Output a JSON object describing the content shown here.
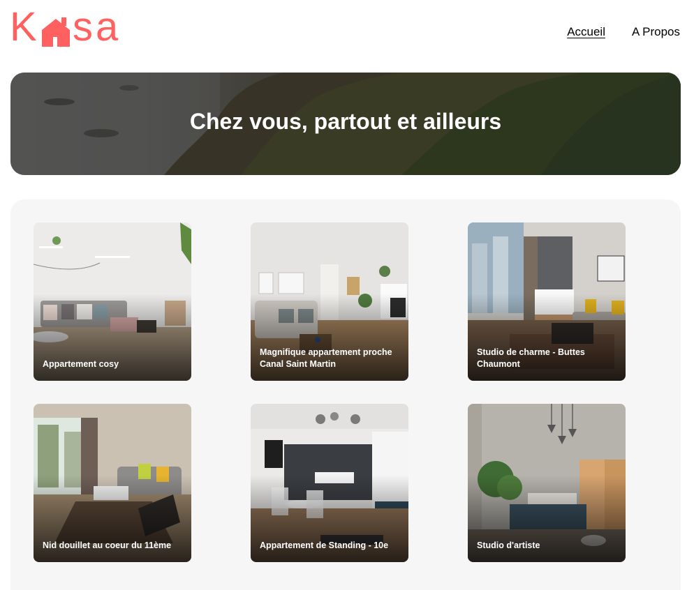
{
  "header": {
    "logo": {
      "text_left": "K",
      "text_right": "sa",
      "color": "#FF6060",
      "icon": "house-icon"
    },
    "nav": [
      {
        "label": "Accueil",
        "active": true
      },
      {
        "label": "A Propos",
        "active": false
      }
    ]
  },
  "banner": {
    "title": "Chez vous, partout et ailleurs"
  },
  "gallery": {
    "cards": [
      {
        "title": "Appartement cosy"
      },
      {
        "title": "Magnifique appartement proche Canal Saint Martin"
      },
      {
        "title": "Studio de charme - Buttes Chaumont"
      },
      {
        "title": "Nid douillet au coeur du 11ème"
      },
      {
        "title": "Appartement de Standing - 10e"
      },
      {
        "title": "Studio d'artiste"
      }
    ]
  }
}
